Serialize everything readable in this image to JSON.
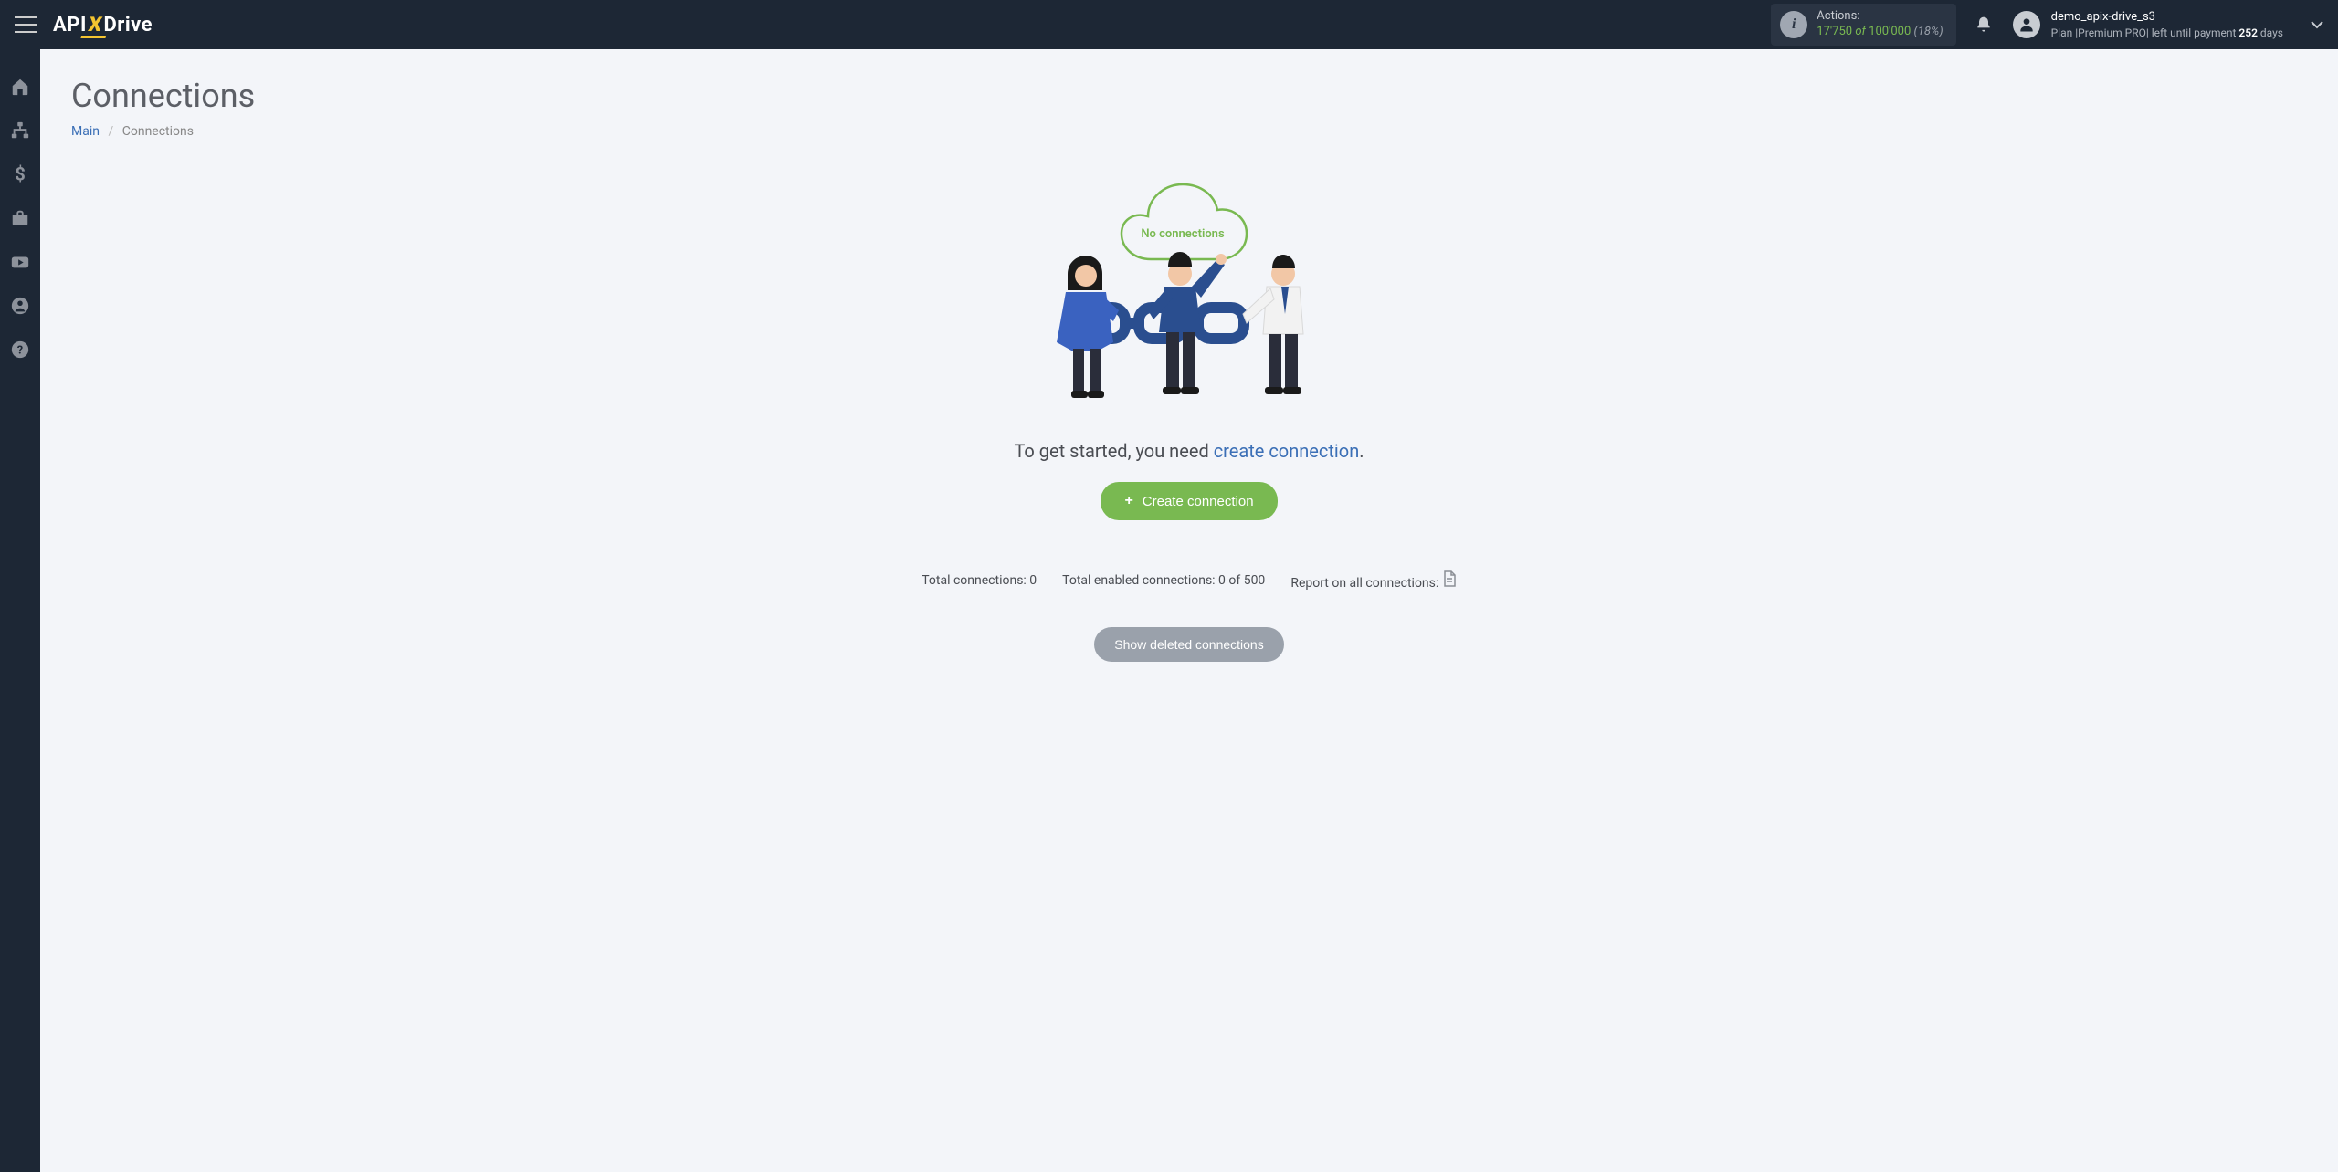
{
  "brand": {
    "pre": "API",
    "x": "X",
    "post": "Drive"
  },
  "actions": {
    "label": "Actions:",
    "used": "17'750",
    "of": "of",
    "total": "100'000",
    "pct": "(18%)"
  },
  "user": {
    "name": "demo_apix-drive_s3",
    "plan_pre": "Plan |",
    "plan_name": "Premium PRO",
    "plan_mid": "| left until payment ",
    "days_num": "252",
    "days_word": " days"
  },
  "page": {
    "title": "Connections",
    "crumb_main": "Main",
    "crumb_current": "Connections"
  },
  "empty": {
    "cloud_text": "No connections",
    "prompt_pre": "To get started, you need ",
    "prompt_link": "create connection",
    "prompt_post": ".",
    "create_btn": "Create connection"
  },
  "stats": {
    "total": "Total connections: 0",
    "enabled": "Total enabled connections: 0 of 500",
    "report": "Report on all connections:"
  },
  "deleted_btn": "Show deleted connections"
}
